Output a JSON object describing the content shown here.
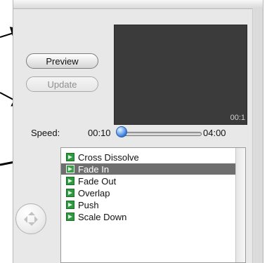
{
  "buttons": {
    "preview_label": "Preview",
    "update_label": "Update"
  },
  "viewer": {
    "timecode": "00:1"
  },
  "speed": {
    "label": "Speed:",
    "min": "00:10",
    "max": "04:00",
    "value_fraction": 0.0
  },
  "transitions": {
    "items": [
      {
        "label": "Cross Dissolve",
        "icon": "cross-dissolve-icon",
        "selected": false
      },
      {
        "label": "Fade In",
        "icon": "fade-in-icon",
        "selected": true
      },
      {
        "label": "Fade Out",
        "icon": "fade-out-icon",
        "selected": false
      },
      {
        "label": "Overlap",
        "icon": "overlap-icon",
        "selected": false
      },
      {
        "label": "Push",
        "icon": "push-icon",
        "selected": false
      },
      {
        "label": "Scale Down",
        "icon": "scale-down-icon",
        "selected": false
      }
    ]
  },
  "colors": {
    "selection": "#6e6e6e",
    "slider_knob": "#3b78d8",
    "icon_green": "#2e9a3f"
  }
}
